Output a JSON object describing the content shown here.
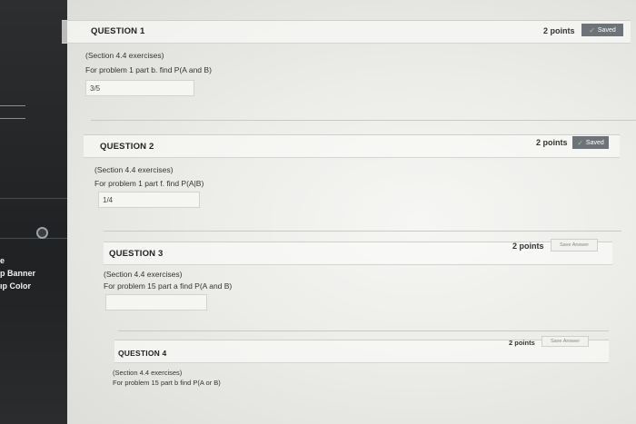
{
  "sidebar": {
    "texts": [
      "e",
      "p Banner",
      "ıp Color"
    ]
  },
  "questions": [
    {
      "title": "QUESTION 1",
      "points": "2 points",
      "status": "Saved",
      "section": "(Section 4.4 exercises)",
      "prompt": "For problem 1 part b. find P(A and B)",
      "answer": "3/5"
    },
    {
      "title": "QUESTION 2",
      "points": "2 points",
      "status": "Saved",
      "section": "(Section 4.4 exercises)",
      "prompt": "For problem 1 part f. find P(A|B)",
      "answer": "1/4"
    },
    {
      "title": "QUESTION 3",
      "points": "2 points",
      "status": "Save Answer",
      "section": "(Section 4.4 exercises)",
      "prompt": "For problem 15 part a find P(A and B)",
      "answer": ""
    },
    {
      "title": "QUESTION 4",
      "points": "2 points",
      "status": "Save Answer",
      "section": "(Section 4.4 exercises)",
      "prompt": "For problem 15 part b find P(A or B)",
      "answer": ""
    }
  ],
  "colors": {
    "sidebar": "#1f2123",
    "saved_button": "#6d7378",
    "saved_check": "#9fd08a"
  }
}
